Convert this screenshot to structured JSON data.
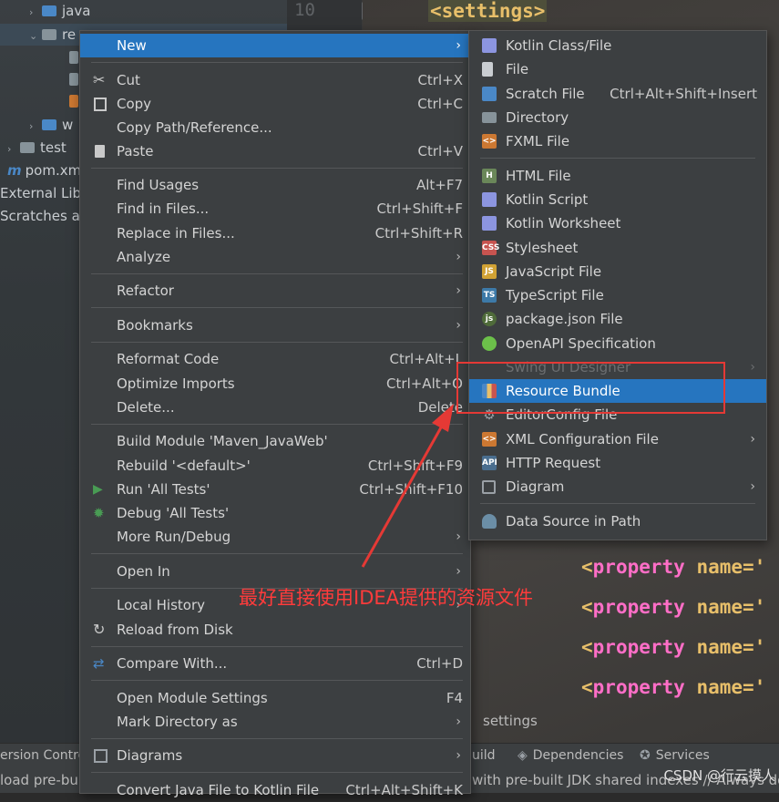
{
  "editor": {
    "line_number": "10",
    "settings_tag": "<settings>",
    "property_keyword": "property",
    "property_attr": "name=",
    "property_lines": [
      "<property name='",
      "<property name='",
      "<property name='",
      "<property name='"
    ],
    "breadcrumb": "settings"
  },
  "project_tree": [
    {
      "label": "java",
      "indent": 1,
      "arrow": "›",
      "folder": "blue"
    },
    {
      "label": "re",
      "indent": 1,
      "arrow": "⌄",
      "folder": "gray"
    },
    {
      "label": "w",
      "indent": 1,
      "arrow": "›",
      "folder": "gray"
    },
    {
      "label": "test",
      "indent": 0,
      "arrow": "›",
      "folder": "gray"
    },
    {
      "label": "pom.xm",
      "indent": 0,
      "arrow": "",
      "folder": "m"
    },
    {
      "label": "External Lib",
      "indent": 0,
      "arrow": "",
      "folder": "lib"
    },
    {
      "label": "Scratches a",
      "indent": 0,
      "arrow": "",
      "folder": "scratch"
    }
  ],
  "context_menu": {
    "new": "New",
    "cut": "Cut",
    "cut_sc": "Ctrl+X",
    "copy": "Copy",
    "copy_sc": "Ctrl+C",
    "copy_path": "Copy Path/Reference...",
    "paste": "Paste",
    "paste_sc": "Ctrl+V",
    "find_usages": "Find Usages",
    "find_usages_sc": "Alt+F7",
    "find_in_files": "Find in Files...",
    "find_in_files_sc": "Ctrl+Shift+F",
    "replace_in_files": "Replace in Files...",
    "replace_in_files_sc": "Ctrl+Shift+R",
    "analyze": "Analyze",
    "refactor": "Refactor",
    "bookmarks": "Bookmarks",
    "reformat_code": "Reformat Code",
    "reformat_code_sc": "Ctrl+Alt+L",
    "optimize_imports": "Optimize Imports",
    "optimize_imports_sc": "Ctrl+Alt+O",
    "delete": "Delete...",
    "delete_sc": "Delete",
    "build_module": "Build Module 'Maven_JavaWeb'",
    "rebuild": "Rebuild '<default>'",
    "rebuild_sc": "Ctrl+Shift+F9",
    "run_tests": "Run 'All Tests'",
    "run_tests_sc": "Ctrl+Shift+F10",
    "debug_tests": "Debug 'All Tests'",
    "more_run": "More Run/Debug",
    "open_in": "Open In",
    "local_history": "Local History",
    "reload": "Reload from Disk",
    "compare_with": "Compare With...",
    "compare_with_sc": "Ctrl+D",
    "module_settings": "Open Module Settings",
    "module_settings_sc": "F4",
    "mark_directory": "Mark Directory as",
    "diagrams": "Diagrams",
    "convert_java": "Convert Java File to Kotlin File",
    "convert_java_sc": "Ctrl+Alt+Shift+K"
  },
  "new_submenu": {
    "kotlin_class": "Kotlin Class/File",
    "file": "File",
    "scratch_file": "Scratch File",
    "scratch_file_sc": "Ctrl+Alt+Shift+Insert",
    "directory": "Directory",
    "fxml_file": "FXML File",
    "html_file": "HTML File",
    "kotlin_script": "Kotlin Script",
    "kotlin_worksheet": "Kotlin Worksheet",
    "stylesheet": "Stylesheet",
    "javascript_file": "JavaScript File",
    "typescript_file": "TypeScript File",
    "package_json": "package.json File",
    "openapi": "OpenAPI Specification",
    "swing_ui": "Swing UI Designer",
    "resource_bundle": "Resource Bundle",
    "editorconfig": "EditorConfig File",
    "xml_config": "XML Configuration File",
    "http_request": "HTTP Request",
    "diagram": "Diagram",
    "data_source": "Data Source in Path"
  },
  "status_bar": {
    "version_control": "ersion Control",
    "build": "uild",
    "dependencies": "Dependencies",
    "services": "Services",
    "message_left": "load pre-bu",
    "message_right": "with pre-built JDK shared indexes // Always dow"
  },
  "annotation": {
    "text": "最好直接使用IDEA提供的资源文件",
    "color": "#ff3b3b"
  },
  "watermark": "CSDN @行云摸人",
  "colors": {
    "selection": "#2675bf",
    "menu_bg": "#3c3f41",
    "annotation_red": "#e53935"
  }
}
